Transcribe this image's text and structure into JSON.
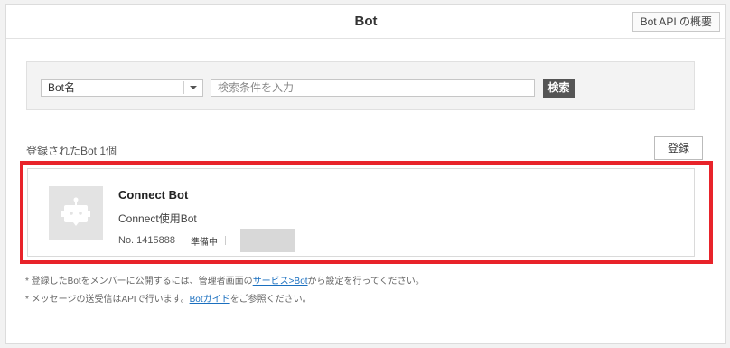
{
  "header": {
    "title": "Bot",
    "api_button_label": "Bot API の概要"
  },
  "search": {
    "select_value": "Bot名",
    "placeholder": "検索条件を入力",
    "button_label": "検索"
  },
  "list": {
    "count_text": "登録されたBot 1個",
    "register_label": "登録"
  },
  "bot": {
    "name": "Connect Bot",
    "description": "Connect使用Bot",
    "number": "No. 1415888",
    "status": "準備中"
  },
  "notes": {
    "line1_prefix": "* 登録したBotをメンバーに公開するには、管理者画面の",
    "line1_link": "サービス>Bot",
    "line1_suffix": "から設定を行ってください。",
    "line2_prefix": "* メッセージの送受信はAPIで行います。",
    "line2_link": "Botガイド",
    "line2_suffix": "をご参照ください。"
  },
  "colors": {
    "highlight": "#e8232a",
    "link": "#1a6fbf",
    "search_button": "#555555"
  },
  "icons": {
    "avatar": "robot-icon",
    "select_caret": "chevron-down-icon"
  }
}
